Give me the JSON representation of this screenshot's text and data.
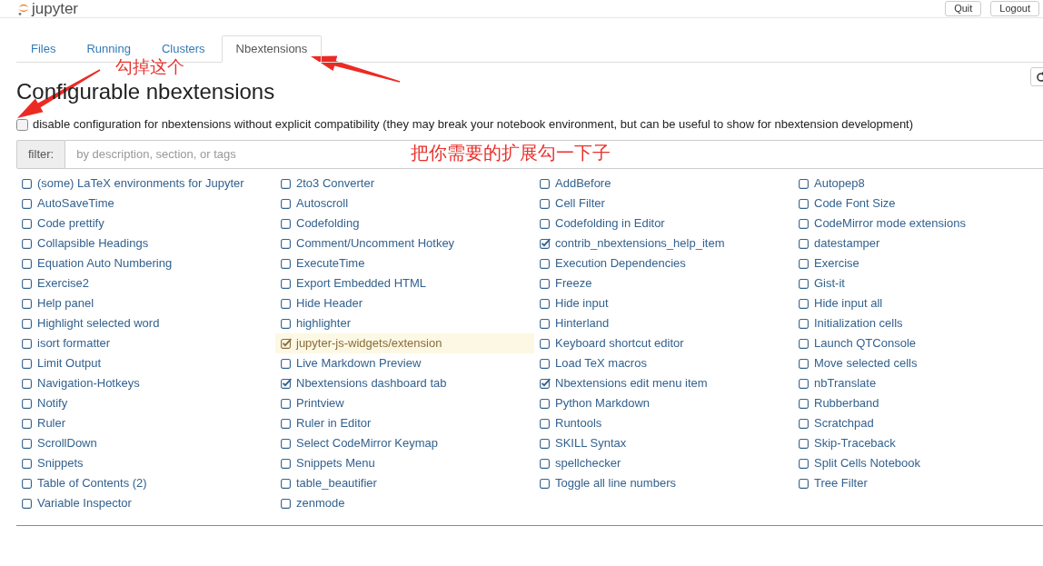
{
  "header": {
    "logo_text": "jupyter",
    "buttons": [
      "Quit",
      "Logout"
    ]
  },
  "tabs": [
    {
      "label": "Files",
      "selected": false
    },
    {
      "label": "Running",
      "selected": false
    },
    {
      "label": "Clusters",
      "selected": false
    },
    {
      "label": "Nbextensions",
      "selected": true
    }
  ],
  "title": "Configurable nbextensions",
  "compat_option": {
    "label": "disable configuration for nbextensions without explicit compatibility (they may break your notebook environment, but can be useful to show for nbextension development)",
    "checked": false
  },
  "filter": {
    "label": "filter:",
    "placeholder": "by description, section, or tags"
  },
  "extensions": [
    {
      "name": "(some) LaTeX environments for Jupyter",
      "checked": false,
      "warning": false
    },
    {
      "name": "2to3 Converter",
      "checked": false,
      "warning": false
    },
    {
      "name": "AddBefore",
      "checked": false,
      "warning": false
    },
    {
      "name": "Autopep8",
      "checked": false,
      "warning": false
    },
    {
      "name": "AutoSaveTime",
      "checked": false,
      "warning": false
    },
    {
      "name": "Autoscroll",
      "checked": false,
      "warning": false
    },
    {
      "name": "Cell Filter",
      "checked": false,
      "warning": false
    },
    {
      "name": "Code Font Size",
      "checked": false,
      "warning": false
    },
    {
      "name": "Code prettify",
      "checked": false,
      "warning": false
    },
    {
      "name": "Codefolding",
      "checked": false,
      "warning": false
    },
    {
      "name": "Codefolding in Editor",
      "checked": false,
      "warning": false
    },
    {
      "name": "CodeMirror mode extensions",
      "checked": false,
      "warning": false
    },
    {
      "name": "Collapsible Headings",
      "checked": false,
      "warning": false
    },
    {
      "name": "Comment/Uncomment Hotkey",
      "checked": false,
      "warning": false
    },
    {
      "name": "contrib_nbextensions_help_item",
      "checked": true,
      "warning": false
    },
    {
      "name": "datestamper",
      "checked": false,
      "warning": false
    },
    {
      "name": "Equation Auto Numbering",
      "checked": false,
      "warning": false
    },
    {
      "name": "ExecuteTime",
      "checked": false,
      "warning": false
    },
    {
      "name": "Execution Dependencies",
      "checked": false,
      "warning": false
    },
    {
      "name": "Exercise",
      "checked": false,
      "warning": false
    },
    {
      "name": "Exercise2",
      "checked": false,
      "warning": false
    },
    {
      "name": "Export Embedded HTML",
      "checked": false,
      "warning": false
    },
    {
      "name": "Freeze",
      "checked": false,
      "warning": false
    },
    {
      "name": "Gist-it",
      "checked": false,
      "warning": false
    },
    {
      "name": "Help panel",
      "checked": false,
      "warning": false
    },
    {
      "name": "Hide Header",
      "checked": false,
      "warning": false
    },
    {
      "name": "Hide input",
      "checked": false,
      "warning": false
    },
    {
      "name": "Hide input all",
      "checked": false,
      "warning": false
    },
    {
      "name": "Highlight selected word",
      "checked": false,
      "warning": false
    },
    {
      "name": "highlighter",
      "checked": false,
      "warning": false
    },
    {
      "name": "Hinterland",
      "checked": false,
      "warning": false
    },
    {
      "name": "Initialization cells",
      "checked": false,
      "warning": false
    },
    {
      "name": "isort formatter",
      "checked": false,
      "warning": false
    },
    {
      "name": "jupyter-js-widgets/extension",
      "checked": true,
      "warning": true
    },
    {
      "name": "Keyboard shortcut editor",
      "checked": false,
      "warning": false
    },
    {
      "name": "Launch QTConsole",
      "checked": false,
      "warning": false
    },
    {
      "name": "Limit Output",
      "checked": false,
      "warning": false
    },
    {
      "name": "Live Markdown Preview",
      "checked": false,
      "warning": false
    },
    {
      "name": "Load TeX macros",
      "checked": false,
      "warning": false
    },
    {
      "name": "Move selected cells",
      "checked": false,
      "warning": false
    },
    {
      "name": "Navigation-Hotkeys",
      "checked": false,
      "warning": false
    },
    {
      "name": "Nbextensions dashboard tab",
      "checked": true,
      "warning": false
    },
    {
      "name": "Nbextensions edit menu item",
      "checked": true,
      "warning": false
    },
    {
      "name": "nbTranslate",
      "checked": false,
      "warning": false
    },
    {
      "name": "Notify",
      "checked": false,
      "warning": false
    },
    {
      "name": "Printview",
      "checked": false,
      "warning": false
    },
    {
      "name": "Python Markdown",
      "checked": false,
      "warning": false
    },
    {
      "name": "Rubberband",
      "checked": false,
      "warning": false
    },
    {
      "name": "Ruler",
      "checked": false,
      "warning": false
    },
    {
      "name": "Ruler in Editor",
      "checked": false,
      "warning": false
    },
    {
      "name": "Runtools",
      "checked": false,
      "warning": false
    },
    {
      "name": "Scratchpad",
      "checked": false,
      "warning": false
    },
    {
      "name": "ScrollDown",
      "checked": false,
      "warning": false
    },
    {
      "name": "Select CodeMirror Keymap",
      "checked": false,
      "warning": false
    },
    {
      "name": "SKILL Syntax",
      "checked": false,
      "warning": false
    },
    {
      "name": "Skip-Traceback",
      "checked": false,
      "warning": false
    },
    {
      "name": "Snippets",
      "checked": false,
      "warning": false
    },
    {
      "name": "Snippets Menu",
      "checked": false,
      "warning": false
    },
    {
      "name": "spellchecker",
      "checked": false,
      "warning": false
    },
    {
      "name": "Split Cells Notebook",
      "checked": false,
      "warning": false
    },
    {
      "name": "Table of Contents (2)",
      "checked": false,
      "warning": false
    },
    {
      "name": "table_beautifier",
      "checked": false,
      "warning": false
    },
    {
      "name": "Toggle all line numbers",
      "checked": false,
      "warning": false
    },
    {
      "name": "Tree Filter",
      "checked": false,
      "warning": false
    },
    {
      "name": "Variable Inspector",
      "checked": false,
      "warning": false
    },
    {
      "name": "zenmode",
      "checked": false,
      "warning": false
    }
  ],
  "annotations": [
    {
      "text": "勾掉这个"
    },
    {
      "text": "把你需要的扩展勾一下子"
    }
  ]
}
